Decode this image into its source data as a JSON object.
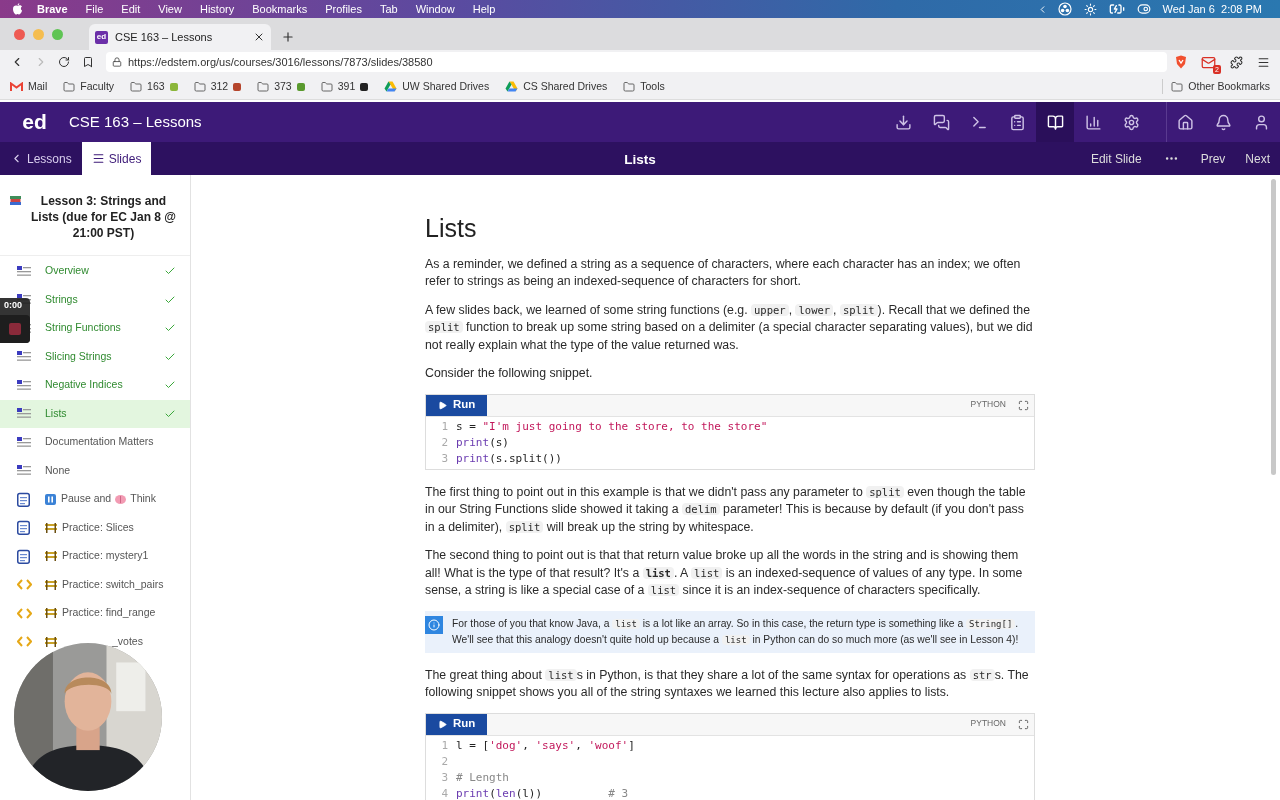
{
  "menubar": {
    "app": "Brave",
    "menus": [
      "File",
      "Edit",
      "View",
      "History",
      "Bookmarks",
      "Profiles",
      "Tab",
      "Window",
      "Help"
    ],
    "clock": "Wed Jan 6  2:08 PM"
  },
  "browser": {
    "tab": {
      "favicon": "ed",
      "title": "CSE 163 – Lessons"
    },
    "url": "https://edstem.org/us/courses/3016/lessons/7873/slides/38580",
    "mail_badge": "2",
    "bookmarks": [
      {
        "kind": "gmail",
        "label": "Mail"
      },
      {
        "kind": "folder",
        "label": "Faculty"
      },
      {
        "kind": "folder",
        "label": "163",
        "color": "#8bb63a"
      },
      {
        "kind": "folder",
        "label": "312",
        "color": "#b5452c"
      },
      {
        "kind": "folder",
        "label": "373",
        "color": "#5a9a2e"
      },
      {
        "kind": "folder",
        "label": "391",
        "color": "#222222"
      },
      {
        "kind": "drive",
        "label": "UW Shared Drives"
      },
      {
        "kind": "drive",
        "label": "CS Shared Drives"
      },
      {
        "kind": "folder",
        "label": "Tools"
      }
    ],
    "other_bookmarks": "Other Bookmarks"
  },
  "app": {
    "logo": "ed",
    "title": "CSE 163 – Lessons",
    "tools": [
      {
        "kind": "download",
        "selected": false
      },
      {
        "kind": "chat",
        "selected": false
      },
      {
        "kind": "terminal",
        "selected": false
      },
      {
        "kind": "clipboard",
        "selected": false
      },
      {
        "kind": "lessons",
        "selected": true
      },
      {
        "kind": "chart",
        "selected": false
      },
      {
        "kind": "settings",
        "selected": false
      },
      {
        "kind": "home",
        "selected": false
      },
      {
        "kind": "bell",
        "selected": false
      },
      {
        "kind": "user",
        "selected": false
      }
    ],
    "tabs": [
      {
        "kind": "back",
        "label": "Lessons",
        "selected": false
      },
      {
        "kind": "list",
        "label": "Slides",
        "selected": true
      }
    ],
    "slide_title": "Lists",
    "actions": [
      {
        "kind": "text",
        "label": "Edit Slide"
      },
      {
        "kind": "more"
      },
      {
        "kind": "text",
        "label": "Prev"
      },
      {
        "kind": "text",
        "label": "Next"
      }
    ]
  },
  "sidebar": {
    "lesson_title": "Lesson 3: Strings and Lists (due for EC Jan 8 @ 21:00 PST)",
    "items": [
      {
        "kind": "slide",
        "label": "Overview",
        "completed": true,
        "selected": false
      },
      {
        "kind": "slide",
        "label": "Strings",
        "completed": true,
        "selected": false
      },
      {
        "kind": "slide",
        "label": "String Functions",
        "completed": true,
        "selected": false
      },
      {
        "kind": "slide",
        "label": "Slicing Strings",
        "completed": true,
        "selected": false
      },
      {
        "kind": "slide",
        "label": "Negative Indices",
        "completed": true,
        "selected": false
      },
      {
        "kind": "slide",
        "label": "Lists",
        "completed": true,
        "selected": true
      },
      {
        "kind": "slide",
        "label": "Documentation Matters",
        "completed": false,
        "selected": false
      },
      {
        "kind": "slide",
        "label": "None",
        "completed": false,
        "selected": false
      },
      {
        "kind": "quiz",
        "prefix": {
          "kind": "pause"
        },
        "label": "Pause and",
        "label_after": "Think",
        "completed": false,
        "selected": false
      },
      {
        "kind": "quiz",
        "prefix": {
          "kind": "fence"
        },
        "label": "Practice: Slices",
        "completed": false,
        "selected": false
      },
      {
        "kind": "quiz",
        "prefix": {
          "kind": "fence"
        },
        "label": "Practice: mystery1",
        "completed": false,
        "selected": false
      },
      {
        "kind": "code",
        "prefix": {
          "kind": "fence"
        },
        "label": "Practice: switch_pairs",
        "completed": false,
        "selected": false
      },
      {
        "kind": "code",
        "prefix": {
          "kind": "fence"
        },
        "label": "Practice: find_range",
        "completed": false,
        "selected": false
      },
      {
        "kind": "code",
        "prefix": {
          "kind": "fence"
        },
        "label_tail": "_votes",
        "completed": false,
        "selected": false
      }
    ]
  },
  "recording": {
    "timer": "0:00"
  },
  "content": {
    "title": "Lists",
    "blocks": [
      {
        "kind": "paragraph",
        "parts": [
          {
            "kind": "text",
            "text": "As a reminder, we defined a string as a sequence of characters, where each character has an index; we often refer to strings as being an indexed-sequence of characters for short."
          }
        ]
      },
      {
        "kind": "paragraph",
        "parts": [
          {
            "kind": "text",
            "text": "A few slides back, we learned of some string functions (e.g. "
          },
          {
            "kind": "code",
            "text": "upper"
          },
          {
            "kind": "text",
            "text": ", "
          },
          {
            "kind": "code",
            "text": "lower"
          },
          {
            "kind": "text",
            "text": ", "
          },
          {
            "kind": "code",
            "text": "split"
          },
          {
            "kind": "text",
            "text": "). Recall that we defined the "
          },
          {
            "kind": "code",
            "text": "split"
          },
          {
            "kind": "text",
            "text": " function to break up some string based on a delimiter (a special character separating values), but we did not really explain what the type of the value returned was."
          }
        ]
      },
      {
        "kind": "paragraph",
        "parts": [
          {
            "kind": "text",
            "text": "Consider the following snippet."
          }
        ]
      },
      {
        "kind": "code",
        "language": "PYTHON",
        "run": "Run",
        "lines": [
          {
            "number": "1",
            "tokens": [
              {
                "kind": "plain",
                "text": "s = "
              },
              {
                "kind": "string",
                "text": "\"I'm just going to the store, to the store\""
              }
            ]
          },
          {
            "number": "2",
            "tokens": [
              {
                "kind": "func",
                "text": "print"
              },
              {
                "kind": "plain",
                "text": "(s)"
              }
            ]
          },
          {
            "number": "3",
            "tokens": [
              {
                "kind": "func",
                "text": "print"
              },
              {
                "kind": "plain",
                "text": "(s.split())"
              }
            ]
          }
        ]
      },
      {
        "kind": "paragraph",
        "parts": [
          {
            "kind": "text",
            "text": "The first thing to point out in this example is that we didn't pass any parameter to "
          },
          {
            "kind": "code",
            "text": "split"
          },
          {
            "kind": "text",
            "text": " even though the table in our String Functions slide showed it taking a "
          },
          {
            "kind": "code",
            "text": "delim"
          },
          {
            "kind": "text",
            "text": " parameter! This is because by default (if you don't pass in a delimiter), "
          },
          {
            "kind": "code",
            "text": "split"
          },
          {
            "kind": "text",
            "text": " will break up the string by whitespace."
          }
        ]
      },
      {
        "kind": "paragraph",
        "parts": [
          {
            "kind": "text",
            "text": "The second thing to point out is that that return value broke up all the words in the string and is showing them all! What is the type of that result? It's a "
          },
          {
            "kind": "code_bold",
            "text": "list"
          },
          {
            "kind": "text",
            "text": ". A "
          },
          {
            "kind": "code",
            "text": "list"
          },
          {
            "kind": "text",
            "text": " is an indexed-sequence of values of any type. In some sense, a string is like a special case of a "
          },
          {
            "kind": "code",
            "text": "list"
          },
          {
            "kind": "text",
            "text": " since it is an index-sequence of characters specifically."
          }
        ]
      },
      {
        "kind": "callout",
        "parts": [
          {
            "kind": "text",
            "text": "For those of you that know Java, a "
          },
          {
            "kind": "code",
            "text": "list"
          },
          {
            "kind": "text",
            "text": " is a lot like an array. So in this case, the return type is something like a "
          },
          {
            "kind": "code",
            "text": "String[]"
          },
          {
            "kind": "text",
            "text": ". We'll see that this analogy doesn't quite hold up because a "
          },
          {
            "kind": "code",
            "text": "list"
          },
          {
            "kind": "text",
            "text": " in Python can do so much more (as we'll see in Lesson 4)!"
          }
        ]
      },
      {
        "kind": "paragraph",
        "parts": [
          {
            "kind": "text",
            "text": "The great thing about "
          },
          {
            "kind": "code",
            "text": "list"
          },
          {
            "kind": "text",
            "text": "s in Python, is that they share a lot of the same syntax for operations as "
          },
          {
            "kind": "code",
            "text": "str"
          },
          {
            "kind": "text",
            "text": "s. The following snippet shows you all of the string syntaxes we learned this lecture also applies to lists."
          }
        ]
      },
      {
        "kind": "code",
        "language": "PYTHON",
        "run": "Run",
        "lines": [
          {
            "number": "1",
            "tokens": [
              {
                "kind": "plain",
                "text": "l = ["
              },
              {
                "kind": "string",
                "text": "'dog'"
              },
              {
                "kind": "plain",
                "text": ", "
              },
              {
                "kind": "string",
                "text": "'says'"
              },
              {
                "kind": "plain",
                "text": ", "
              },
              {
                "kind": "string",
                "text": "'woof'"
              },
              {
                "kind": "plain",
                "text": "]"
              }
            ]
          },
          {
            "number": "2"
          },
          {
            "number": "3",
            "tokens": [
              {
                "kind": "comment",
                "text": "# Length"
              }
            ]
          },
          {
            "number": "4",
            "tokens": [
              {
                "kind": "func",
                "text": "print"
              },
              {
                "kind": "plain",
                "text": "("
              },
              {
                "kind": "func",
                "text": "len"
              },
              {
                "kind": "plain",
                "text": "(l))          "
              },
              {
                "kind": "comment",
                "text": "# 3"
              }
            ]
          }
        ]
      }
    ]
  }
}
